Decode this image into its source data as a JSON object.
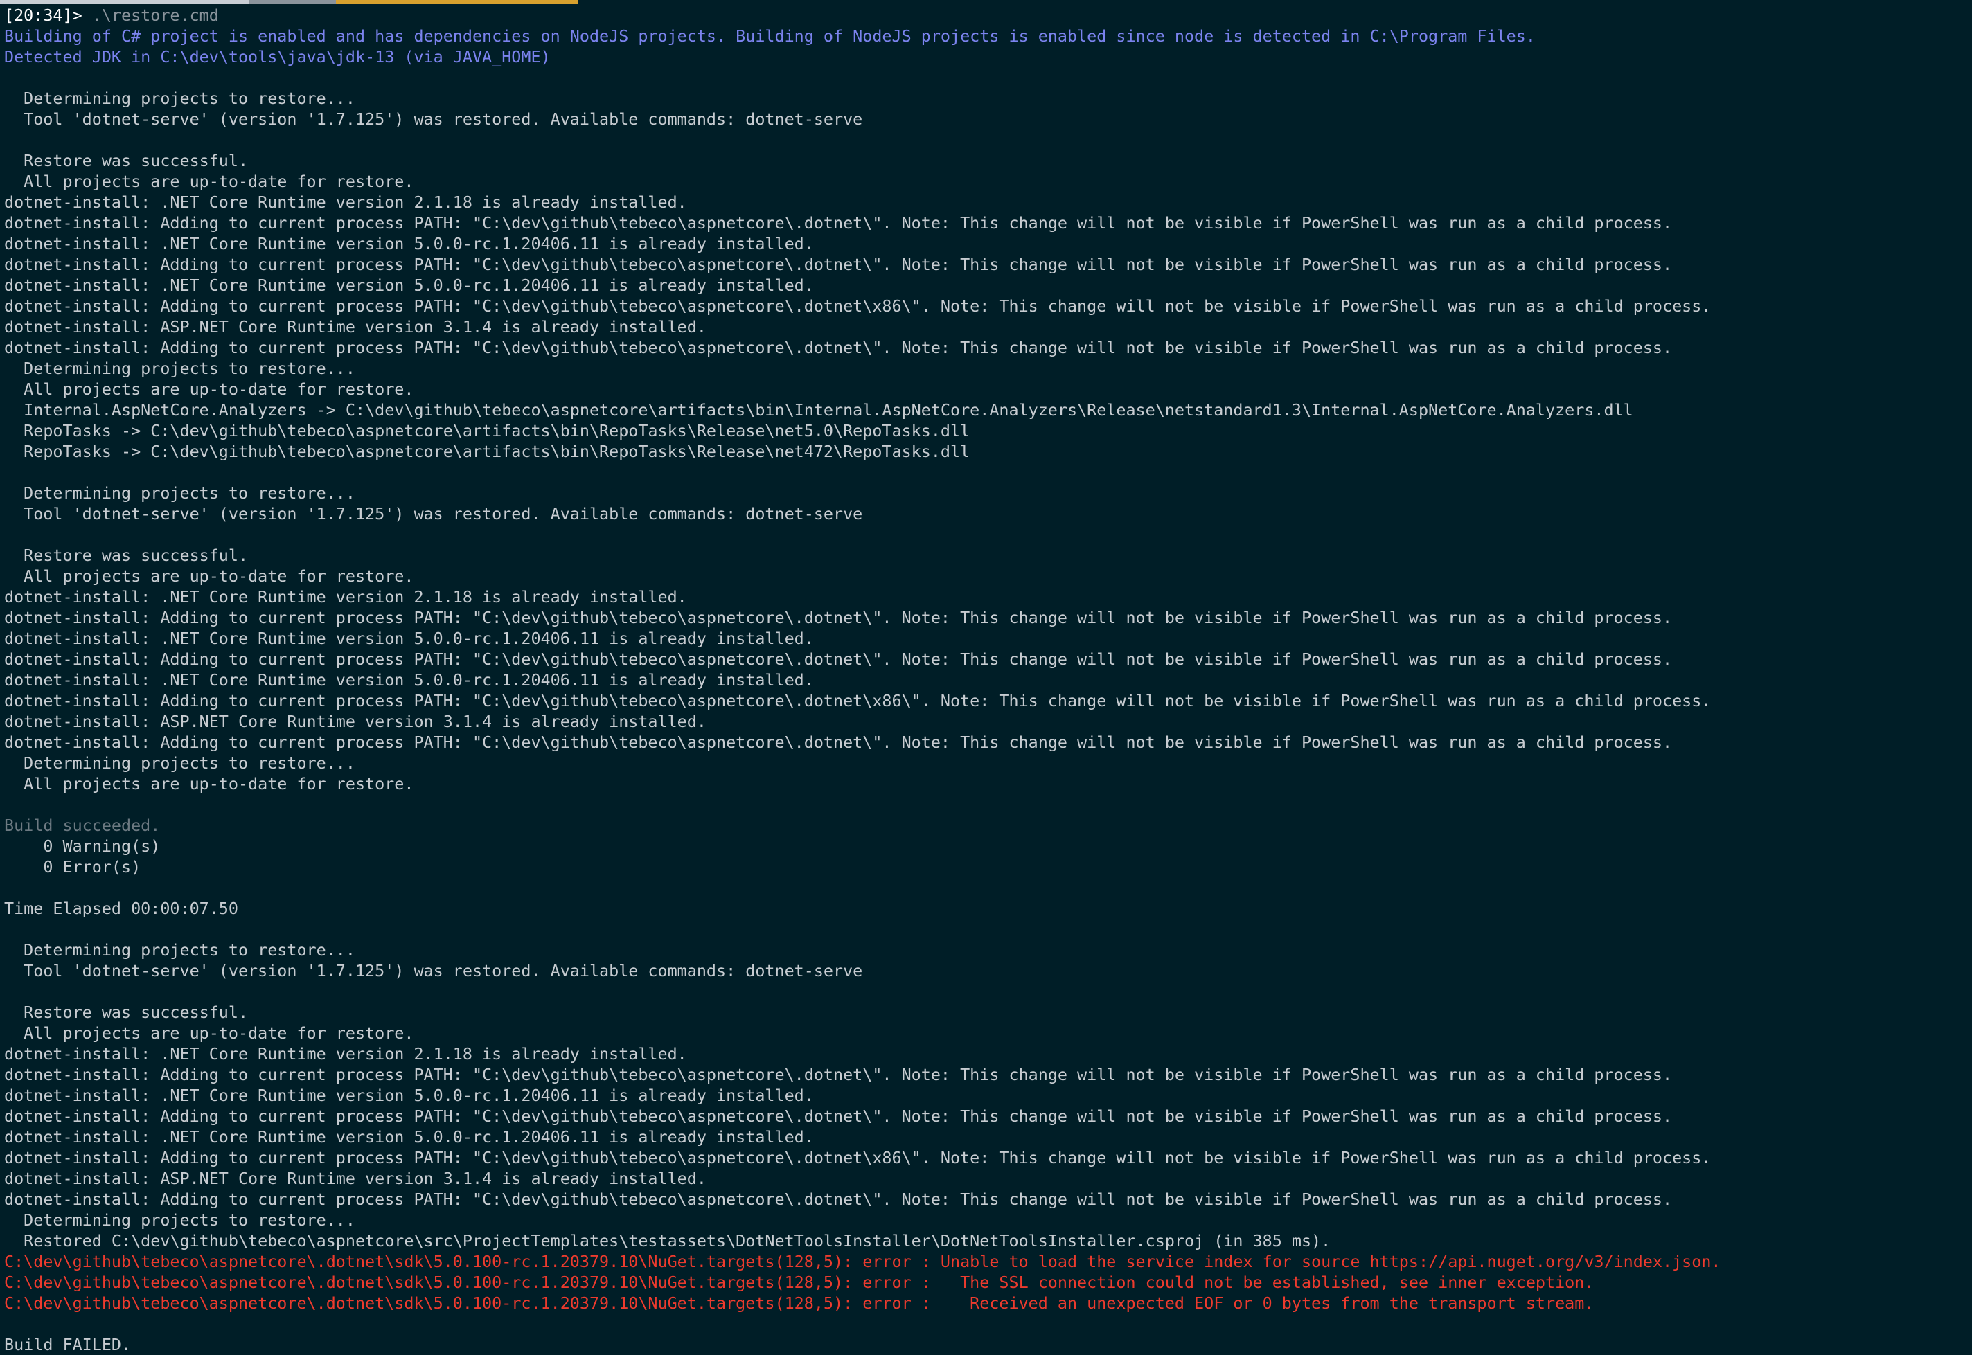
{
  "terminal": {
    "prompt": "[20:34]>",
    "command": " .\\restore.cmd",
    "lines": [
      {
        "t": "Building of C# project is enabled and has dependencies on NodeJS projects. Building of NodeJS projects is enabled since node is detected in C:\\Program Files.",
        "k": "info"
      },
      {
        "t": "Detected JDK in C:\\dev\\tools\\java\\jdk-13 (via JAVA_HOME)",
        "k": "info"
      },
      {
        "t": "",
        "k": "normal"
      },
      {
        "t": "  Determining projects to restore...",
        "k": "normal"
      },
      {
        "t": "  Tool 'dotnet-serve' (version '1.7.125') was restored. Available commands: dotnet-serve",
        "k": "normal"
      },
      {
        "t": "",
        "k": "normal"
      },
      {
        "t": "  Restore was successful.",
        "k": "normal"
      },
      {
        "t": "  All projects are up-to-date for restore.",
        "k": "normal"
      },
      {
        "t": "dotnet-install: .NET Core Runtime version 2.1.18 is already installed.",
        "k": "normal"
      },
      {
        "t": "dotnet-install: Adding to current process PATH: \"C:\\dev\\github\\tebeco\\aspnetcore\\.dotnet\\\". Note: This change will not be visible if PowerShell was run as a child process.",
        "k": "normal"
      },
      {
        "t": "dotnet-install: .NET Core Runtime version 5.0.0-rc.1.20406.11 is already installed.",
        "k": "normal"
      },
      {
        "t": "dotnet-install: Adding to current process PATH: \"C:\\dev\\github\\tebeco\\aspnetcore\\.dotnet\\\". Note: This change will not be visible if PowerShell was run as a child process.",
        "k": "normal"
      },
      {
        "t": "dotnet-install: .NET Core Runtime version 5.0.0-rc.1.20406.11 is already installed.",
        "k": "normal"
      },
      {
        "t": "dotnet-install: Adding to current process PATH: \"C:\\dev\\github\\tebeco\\aspnetcore\\.dotnet\\x86\\\". Note: This change will not be visible if PowerShell was run as a child process.",
        "k": "normal"
      },
      {
        "t": "dotnet-install: ASP.NET Core Runtime version 3.1.4 is already installed.",
        "k": "normal"
      },
      {
        "t": "dotnet-install: Adding to current process PATH: \"C:\\dev\\github\\tebeco\\aspnetcore\\.dotnet\\\". Note: This change will not be visible if PowerShell was run as a child process.",
        "k": "normal"
      },
      {
        "t": "  Determining projects to restore...",
        "k": "normal"
      },
      {
        "t": "  All projects are up-to-date for restore.",
        "k": "normal"
      },
      {
        "t": "  Internal.AspNetCore.Analyzers -> C:\\dev\\github\\tebeco\\aspnetcore\\artifacts\\bin\\Internal.AspNetCore.Analyzers\\Release\\netstandard1.3\\Internal.AspNetCore.Analyzers.dll",
        "k": "normal"
      },
      {
        "t": "  RepoTasks -> C:\\dev\\github\\tebeco\\aspnetcore\\artifacts\\bin\\RepoTasks\\Release\\net5.0\\RepoTasks.dll",
        "k": "normal"
      },
      {
        "t": "  RepoTasks -> C:\\dev\\github\\tebeco\\aspnetcore\\artifacts\\bin\\RepoTasks\\Release\\net472\\RepoTasks.dll",
        "k": "normal"
      },
      {
        "t": "",
        "k": "normal"
      },
      {
        "t": "  Determining projects to restore...",
        "k": "normal"
      },
      {
        "t": "  Tool 'dotnet-serve' (version '1.7.125') was restored. Available commands: dotnet-serve",
        "k": "normal"
      },
      {
        "t": "",
        "k": "normal"
      },
      {
        "t": "  Restore was successful.",
        "k": "normal"
      },
      {
        "t": "  All projects are up-to-date for restore.",
        "k": "normal"
      },
      {
        "t": "dotnet-install: .NET Core Runtime version 2.1.18 is already installed.",
        "k": "normal"
      },
      {
        "t": "dotnet-install: Adding to current process PATH: \"C:\\dev\\github\\tebeco\\aspnetcore\\.dotnet\\\". Note: This change will not be visible if PowerShell was run as a child process.",
        "k": "normal"
      },
      {
        "t": "dotnet-install: .NET Core Runtime version 5.0.0-rc.1.20406.11 is already installed.",
        "k": "normal"
      },
      {
        "t": "dotnet-install: Adding to current process PATH: \"C:\\dev\\github\\tebeco\\aspnetcore\\.dotnet\\\". Note: This change will not be visible if PowerShell was run as a child process.",
        "k": "normal"
      },
      {
        "t": "dotnet-install: .NET Core Runtime version 5.0.0-rc.1.20406.11 is already installed.",
        "k": "normal"
      },
      {
        "t": "dotnet-install: Adding to current process PATH: \"C:\\dev\\github\\tebeco\\aspnetcore\\.dotnet\\x86\\\". Note: This change will not be visible if PowerShell was run as a child process.",
        "k": "normal"
      },
      {
        "t": "dotnet-install: ASP.NET Core Runtime version 3.1.4 is already installed.",
        "k": "normal"
      },
      {
        "t": "dotnet-install: Adding to current process PATH: \"C:\\dev\\github\\tebeco\\aspnetcore\\.dotnet\\\". Note: This change will not be visible if PowerShell was run as a child process.",
        "k": "normal"
      },
      {
        "t": "  Determining projects to restore...",
        "k": "normal"
      },
      {
        "t": "  All projects are up-to-date for restore.",
        "k": "normal"
      },
      {
        "t": "",
        "k": "normal"
      },
      {
        "t": "Build succeeded.",
        "k": "muted"
      },
      {
        "t": "    0 Warning(s)",
        "k": "normal"
      },
      {
        "t": "    0 Error(s)",
        "k": "normal"
      },
      {
        "t": "",
        "k": "normal"
      },
      {
        "t": "Time Elapsed 00:00:07.50",
        "k": "normal"
      },
      {
        "t": "",
        "k": "normal"
      },
      {
        "t": "  Determining projects to restore...",
        "k": "normal"
      },
      {
        "t": "  Tool 'dotnet-serve' (version '1.7.125') was restored. Available commands: dotnet-serve",
        "k": "normal"
      },
      {
        "t": "",
        "k": "normal"
      },
      {
        "t": "  Restore was successful.",
        "k": "normal"
      },
      {
        "t": "  All projects are up-to-date for restore.",
        "k": "normal"
      },
      {
        "t": "dotnet-install: .NET Core Runtime version 2.1.18 is already installed.",
        "k": "normal"
      },
      {
        "t": "dotnet-install: Adding to current process PATH: \"C:\\dev\\github\\tebeco\\aspnetcore\\.dotnet\\\". Note: This change will not be visible if PowerShell was run as a child process.",
        "k": "normal"
      },
      {
        "t": "dotnet-install: .NET Core Runtime version 5.0.0-rc.1.20406.11 is already installed.",
        "k": "normal"
      },
      {
        "t": "dotnet-install: Adding to current process PATH: \"C:\\dev\\github\\tebeco\\aspnetcore\\.dotnet\\\". Note: This change will not be visible if PowerShell was run as a child process.",
        "k": "normal"
      },
      {
        "t": "dotnet-install: .NET Core Runtime version 5.0.0-rc.1.20406.11 is already installed.",
        "k": "normal"
      },
      {
        "t": "dotnet-install: Adding to current process PATH: \"C:\\dev\\github\\tebeco\\aspnetcore\\.dotnet\\x86\\\". Note: This change will not be visible if PowerShell was run as a child process.",
        "k": "normal"
      },
      {
        "t": "dotnet-install: ASP.NET Core Runtime version 3.1.4 is already installed.",
        "k": "normal"
      },
      {
        "t": "dotnet-install: Adding to current process PATH: \"C:\\dev\\github\\tebeco\\aspnetcore\\.dotnet\\\". Note: This change will not be visible if PowerShell was run as a child process.",
        "k": "normal"
      },
      {
        "t": "  Determining projects to restore...",
        "k": "normal"
      },
      {
        "t": "  Restored C:\\dev\\github\\tebeco\\aspnetcore\\src\\ProjectTemplates\\testassets\\DotNetToolsInstaller\\DotNetToolsInstaller.csproj (in 385 ms).",
        "k": "normal"
      },
      {
        "t": "C:\\dev\\github\\tebeco\\aspnetcore\\.dotnet\\sdk\\5.0.100-rc.1.20379.10\\NuGet.targets(128,5): error : Unable to load the service index for source https://api.nuget.org/v3/index.json.",
        "k": "error"
      },
      {
        "t": "C:\\dev\\github\\tebeco\\aspnetcore\\.dotnet\\sdk\\5.0.100-rc.1.20379.10\\NuGet.targets(128,5): error :   The SSL connection could not be established, see inner exception.",
        "k": "error"
      },
      {
        "t": "C:\\dev\\github\\tebeco\\aspnetcore\\.dotnet\\sdk\\5.0.100-rc.1.20379.10\\NuGet.targets(128,5): error :    Received an unexpected EOF or 0 bytes from the transport stream.",
        "k": "error"
      },
      {
        "t": "",
        "k": "normal"
      },
      {
        "t": "Build FAILED.",
        "k": "normal"
      }
    ]
  },
  "colors": {
    "background": "#001e27",
    "text": "#c7ccd1",
    "info": "#7b83ee",
    "error": "#ec3b2e",
    "accent_bar": "#d7a12e"
  }
}
